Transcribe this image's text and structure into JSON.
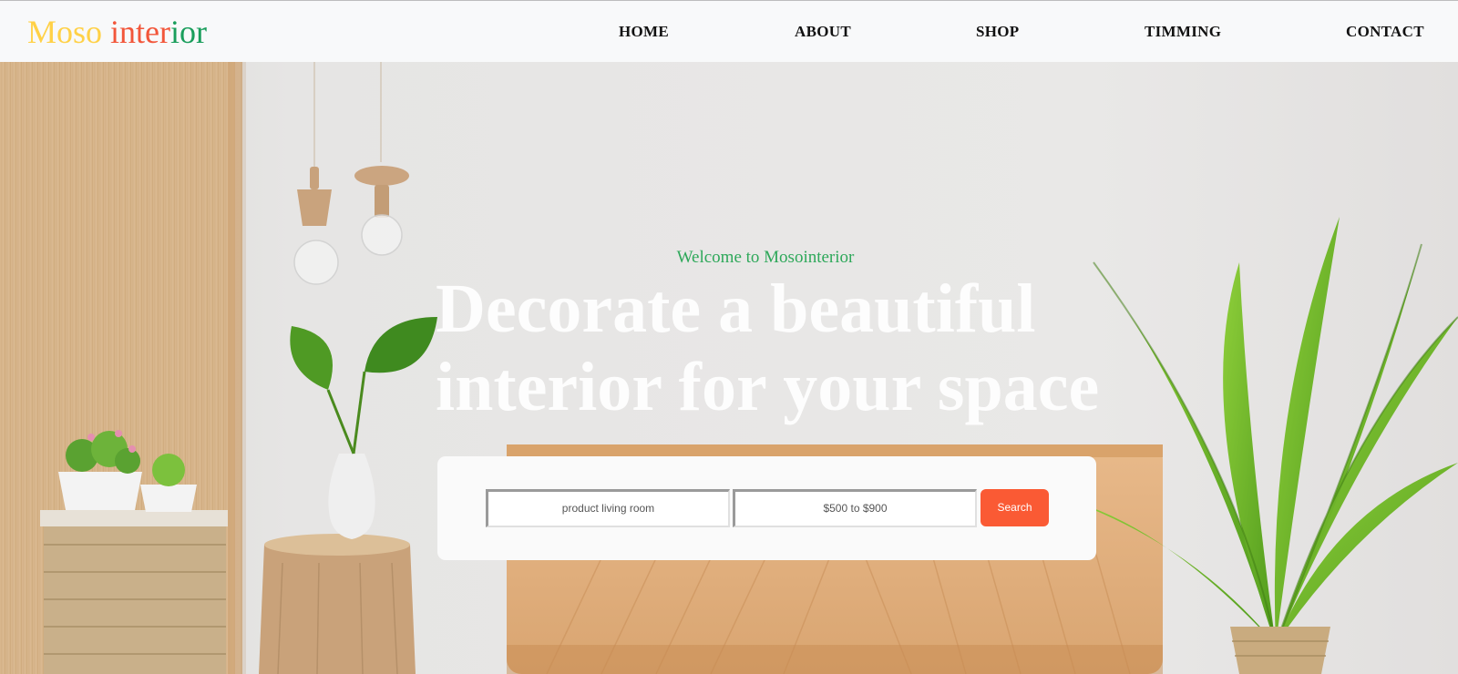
{
  "brand": {
    "logo_part1": "Moso ",
    "logo_part2": "inter",
    "logo_part3": "ior",
    "colors": {
      "part1": "#ffd147",
      "part2": "#f2563a",
      "part3": "#1a9e5c"
    }
  },
  "nav": {
    "home": "HOME",
    "about": "ABOUT",
    "shop": "SHOP",
    "timming": "TIMMING",
    "contact": "CONTACT"
  },
  "hero": {
    "welcome": "Welcome to Mosointerior",
    "headline_line1": "Decorate a beautiful",
    "headline_line2": "interior for your space",
    "background_icon": "interior-room-photo-icon"
  },
  "search": {
    "product_placeholder": "product living room",
    "price_placeholder": "$500 to $900",
    "button_label": "Search",
    "accent_color": "#fa5a34"
  },
  "colors": {
    "welcome_text": "#2ea85a",
    "nav_background": "#f8f9fa"
  }
}
